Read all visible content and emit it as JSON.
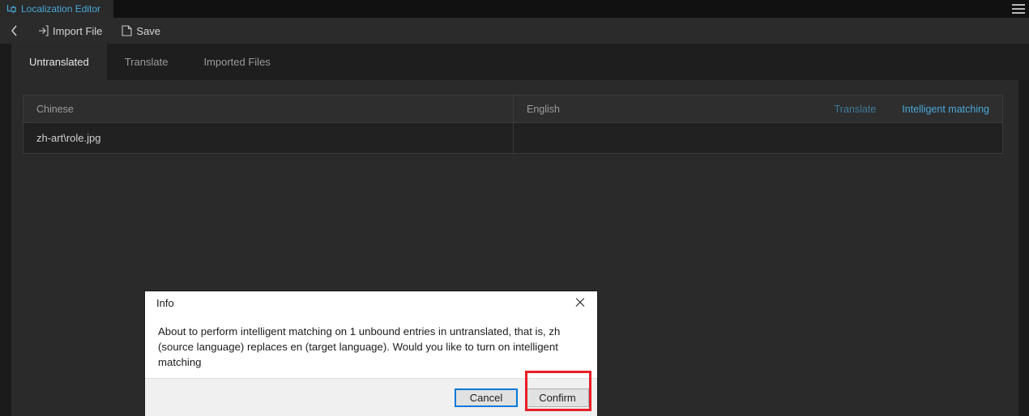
{
  "titlebar": {
    "app_tab_label": "Localization Editor",
    "app_icon": "localization-icon",
    "menu_icon": "hamburger-menu-icon",
    "accent_color": "#4aa8d8"
  },
  "toolbar": {
    "back_icon": "chevron-left-icon",
    "items": [
      {
        "label": "Import File",
        "icon": "import-file-icon"
      },
      {
        "label": "Save",
        "icon": "save-icon"
      }
    ]
  },
  "tabs": [
    {
      "label": "Untranslated",
      "active": true
    },
    {
      "label": "Translate",
      "active": false
    },
    {
      "label": "Imported Files",
      "active": false
    }
  ],
  "table": {
    "columns": [
      "Chinese",
      "English"
    ],
    "actions": [
      {
        "label": "Translate",
        "state": "disabled",
        "color": "#3f7a99"
      },
      {
        "label": "Intelligent matching",
        "state": "enabled",
        "color": "#4aa8d8"
      }
    ],
    "rows": [
      {
        "chinese": "zh-art\\role.jpg",
        "english": ""
      }
    ]
  },
  "dialog": {
    "title": "Info",
    "close_icon": "close-icon",
    "message": "About to perform intelligent matching on 1 unbound entries in untranslated, that is, zh (source language) replaces en (target language). Would you like to turn on intelligent matching",
    "cancel_label": "Cancel",
    "confirm_label": "Confirm",
    "focus_color": "#0078d7",
    "highlight_color": "#e81d25"
  }
}
